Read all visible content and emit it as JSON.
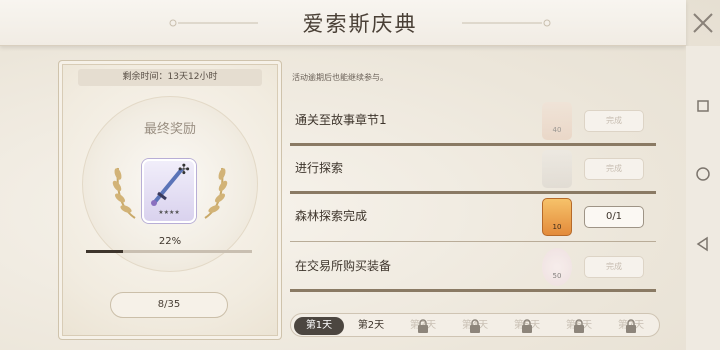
{
  "header": {
    "title": "爱索斯庆典",
    "close_label": "✕"
  },
  "left": {
    "timer": "剩余时间：13天12小时",
    "final_reward_title": "最终奖励",
    "reward_card_caption": "★★★★",
    "progress_percent_label": "22%",
    "progress_value": 0.22,
    "count": "8/35"
  },
  "right": {
    "note": "活动逾期后也能继续参与。",
    "tasks": [
      {
        "label": "通关至故事章节1",
        "icon_value": "40",
        "button": "完成",
        "state": "locked"
      },
      {
        "label": "进行探索",
        "icon_value": "",
        "button": "完成",
        "state": "locked"
      },
      {
        "label": "森林探索完成",
        "icon_value": "10",
        "button": "0/1",
        "state": "active"
      },
      {
        "label": "在交易所购买装备",
        "icon_value": "50",
        "button": "完成",
        "state": "locked"
      }
    ],
    "days": [
      {
        "label": "第1天",
        "state": "active"
      },
      {
        "label": "第2天",
        "state": "normal"
      },
      {
        "label": "第3天",
        "state": "locked"
      },
      {
        "label": "第4天",
        "state": "locked"
      },
      {
        "label": "第5天",
        "state": "locked"
      },
      {
        "label": "第6天",
        "state": "locked"
      },
      {
        "label": "第7天",
        "state": "locked"
      }
    ]
  },
  "colors": {
    "accent_dark": "#3e352c",
    "panel_border": "#cfc3ac",
    "active_tab": "#4c4640"
  },
  "icons": [
    "close-icon",
    "laurel-icon",
    "sword-icon",
    "lock-icon",
    "square-nav-icon",
    "circle-nav-icon",
    "back-nav-icon"
  ]
}
